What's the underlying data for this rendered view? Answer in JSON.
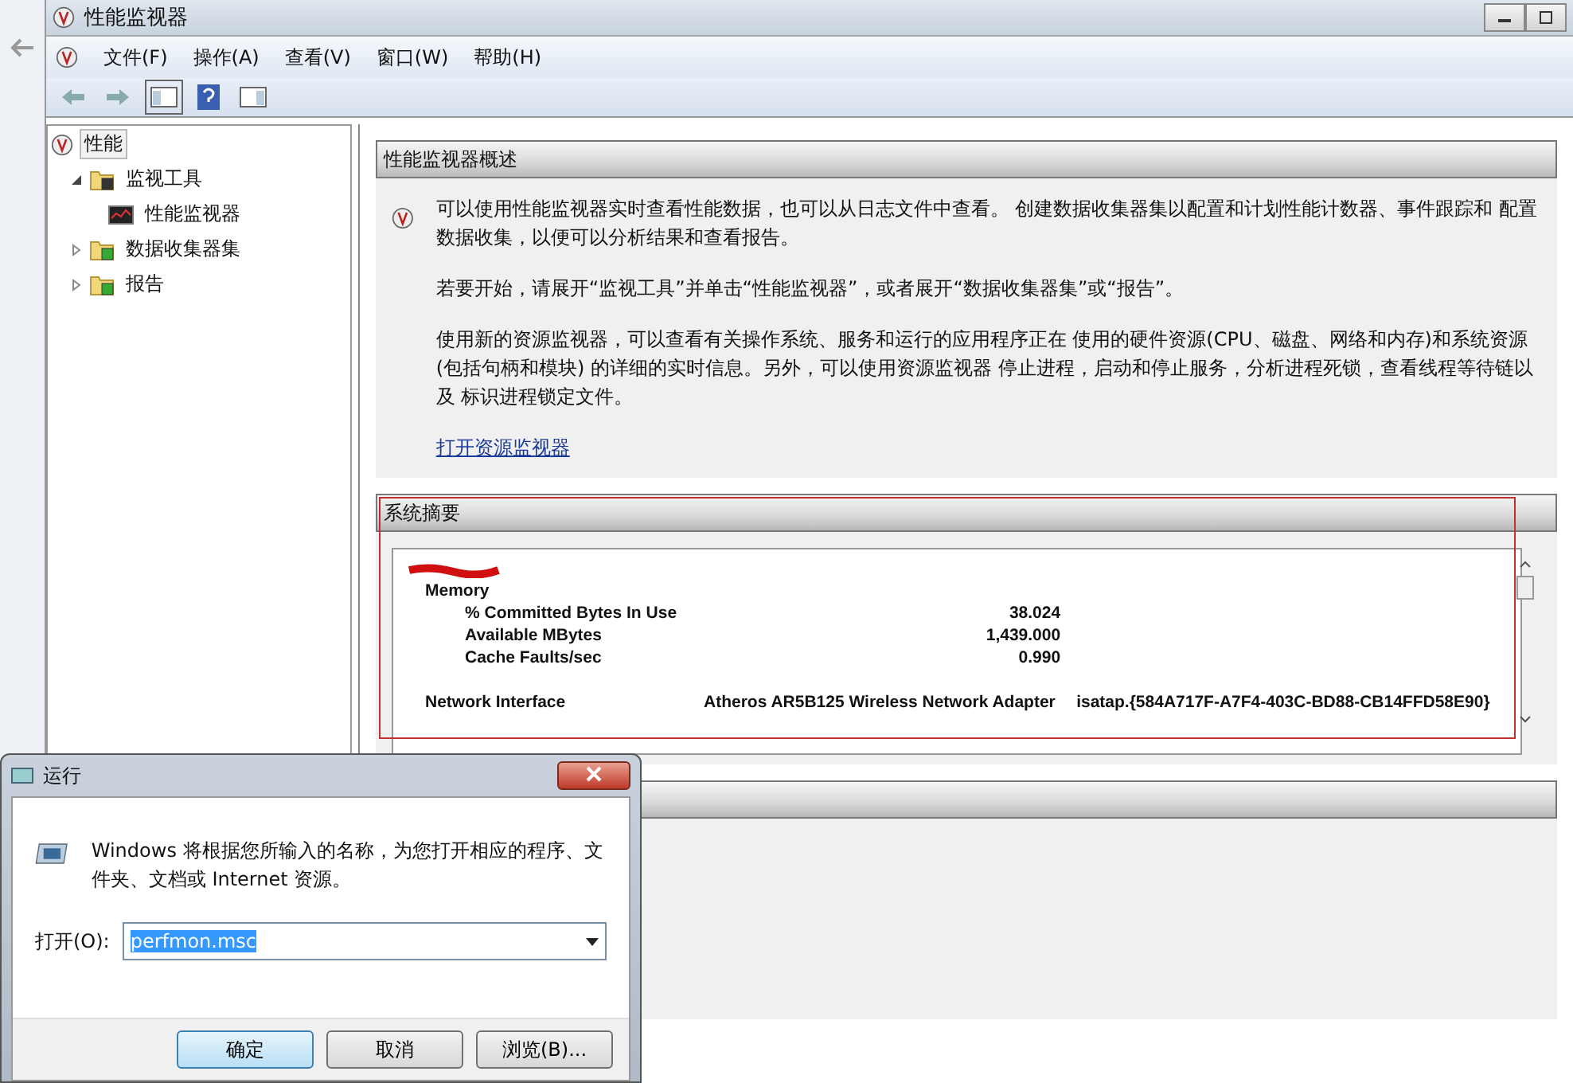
{
  "window": {
    "title": "性能监视器"
  },
  "menu": [
    "文件(F)",
    "操作(A)",
    "查看(V)",
    "窗口(W)",
    "帮助(H)"
  ],
  "tree": [
    {
      "label": "性能",
      "selected": true,
      "children": [
        {
          "label": "监视工具",
          "selected": false,
          "expanded": true,
          "children": [
            {
              "label": "性能监视器",
              "selected": false
            }
          ]
        },
        {
          "label": "数据收集器集",
          "selected": false,
          "expanded": false
        },
        {
          "label": "报告",
          "selected": false,
          "expanded": false
        }
      ]
    }
  ],
  "overview": {
    "title": "性能监视器概述",
    "paragraphs": [
      "可以使用性能监视器实时查看性能数据，也可以从日志文件中查看。 创建数据收集器集以配置和计划性能计数器、事件跟踪和 配置数据收集，以便可以分析结果和查看报告。",
      "若要开始，请展开“监视工具”并单击“性能监视器”，或者展开“数据收集器集”或“报告”。",
      "使用新的资源监视器，可以查看有关操作系统、服务和运行的应用程序正在 使用的硬件资源(CPU、磁盘、网络和内存)和系统资源(包括句柄和模块) 的详细的实时信息。另外，可以使用资源监视器 停止进程，启动和停止服务，分析进程死锁，查看线程等待链以及 标识进程锁定文件。"
    ],
    "link": "打开资源监视器"
  },
  "summary": {
    "title": "系统摘要",
    "groups": [
      {
        "name": "Memory",
        "counters": [
          {
            "name": "% Committed Bytes In Use",
            "value": "38.024"
          },
          {
            "name": "Available MBytes",
            "value": "1,439.000"
          },
          {
            "name": "Cache Faults/sec",
            "value": "0.990"
          }
        ]
      }
    ],
    "network": {
      "name": "Network Interface",
      "instances": [
        "Atheros AR5B125 Wireless Network Adapter",
        "isatap.{584A717F-A7F4-403C-BD88-CB14FFD58E90}"
      ]
    }
  },
  "run_dialog": {
    "title": "运行",
    "message": "Windows 将根据您所输入的名称，为您打开相应的程序、文件夹、文档或 Internet 资源。",
    "open_label": "打开(O):",
    "value": "perfmon.msc",
    "buttons": [
      {
        "label": "确定",
        "default": true
      },
      {
        "label": "取消",
        "default": false
      },
      {
        "label": "浏览(B)...",
        "default": false
      }
    ]
  }
}
